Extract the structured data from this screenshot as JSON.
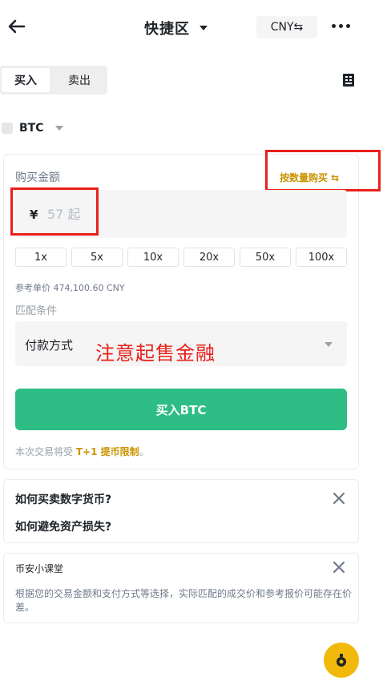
{
  "header": {
    "title": "快捷区",
    "currency_button": "CNY⇆",
    "back_icon": "back-arrow-icon",
    "more_icon": "more-icon"
  },
  "trade_tabs": {
    "buy": "买入",
    "sell": "卖出"
  },
  "coin_selector": {
    "coin": "BTC"
  },
  "amount": {
    "label": "购买金额",
    "toggle_mode": "按数量购买 ⇆",
    "currency_symbol": "¥",
    "placeholder": "57 起"
  },
  "multipliers": [
    "1x",
    "5x",
    "10x",
    "20x",
    "50x",
    "100x"
  ],
  "reference_price": "参考单价 474,100.60 CNY",
  "match_conditions": {
    "label": "匹配条件",
    "payment_method": "付款方式"
  },
  "annotation": "注意起售金融",
  "buy_button": "买入BTC",
  "limit_notice": {
    "prefix": "本次交易将受 ",
    "link": "T+1 提币限制",
    "suffix": "。"
  },
  "faq": {
    "q1": "如何买卖数字货币?",
    "q2": "如何避免资产损失?"
  },
  "classroom": {
    "title": "币安小课堂",
    "body": "根据您的交易金额和支付方式等选择，实际匹配的成交价和参考报价可能存在价差。"
  },
  "colors": {
    "accent_yellow": "#f0b90b",
    "buy_green": "#2ebd85",
    "link_gold": "#c99400",
    "annotation_red": "#e8211b"
  }
}
